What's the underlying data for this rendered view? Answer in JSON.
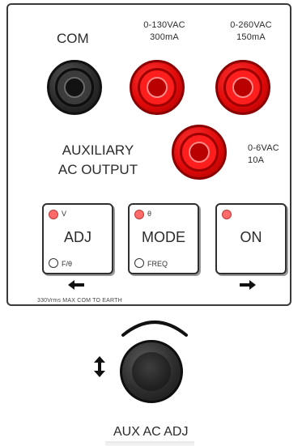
{
  "panel": {
    "com_label": "COM",
    "terminal_130": {
      "line1": "0-130VAC",
      "line2": "300mA"
    },
    "terminal_260": {
      "line1": "0-260VAC",
      "line2": "150mA"
    },
    "terminal_6": {
      "line1": "0-6VAC",
      "line2": "10A"
    },
    "aux_title": {
      "line1": "AUXILIARY",
      "line2": "AC OUTPUT"
    },
    "buttons": {
      "adj": {
        "label": "ADJ",
        "top_led_label": "V",
        "bottom_led_label": "F/θ"
      },
      "mode": {
        "label": "MODE",
        "top_led_label": "θ",
        "bottom_led_label": "FREQ"
      },
      "on": {
        "label": "ON"
      }
    },
    "earth_note": "330Vrms MAX COM TO EARTH"
  },
  "knob": {
    "label": "AUX AC ADJ"
  },
  "colors": {
    "jack_red": "#e10a0a",
    "jack_black": "#2b2b2b",
    "led_red": "#ff6a6a"
  },
  "icons": {
    "adjust_left": "arrow-left-icon",
    "adjust_right": "arrow-right-icon",
    "knob_direction": "updown-arrow-icon",
    "rotation": "arc-rotation-icon"
  }
}
